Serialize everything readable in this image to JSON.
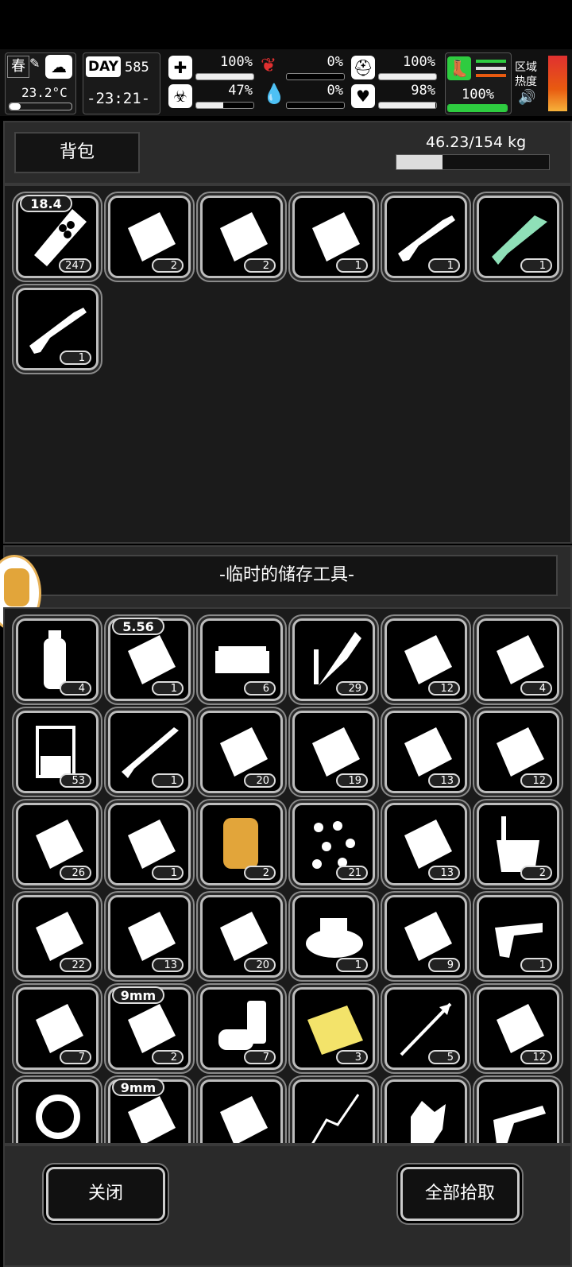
{
  "hud": {
    "season": "春",
    "temperature": "23.2°C",
    "day_label": "DAY",
    "day_number": "585",
    "clock": "-23:21-",
    "health_pct": "100%",
    "health_fill": 1.0,
    "hunger_pct": "0%",
    "hunger_fill": 0.0,
    "armor_pct": "100%",
    "armor_fill": 1.0,
    "infection_pct": "47%",
    "infection_fill": 0.47,
    "thirst_pct": "0%",
    "thirst_fill": 0.0,
    "mood_pct": "98%",
    "mood_fill": 0.98,
    "stamina_pct": "100%",
    "stamina_fill": 1.0,
    "zone_heat_label_1": "区域",
    "zone_heat_label_2": "热度"
  },
  "backpack": {
    "title": "背包",
    "weight": "46.23/154 kg",
    "weight_fill": 0.3,
    "items": [
      {
        "icon": "ammo-roll-icon",
        "tag": "18.4",
        "count": "247"
      },
      {
        "icon": "cloth-rags-icon",
        "count": "2"
      },
      {
        "icon": "paper-sheet-icon",
        "count": "2"
      },
      {
        "icon": "folded-cloth-icon",
        "count": "1"
      },
      {
        "icon": "shotgun-icon",
        "count": "1"
      },
      {
        "icon": "energy-rifle-icon",
        "count": "1"
      },
      {
        "icon": "shotgun-icon",
        "count": "1"
      }
    ]
  },
  "storage": {
    "title": "-临时的储存工具-",
    "items": [
      {
        "icon": "water-bottle-icon",
        "count": "4"
      },
      {
        "icon": "rifle-bullet-icon",
        "tag": "5.56",
        "count": "1"
      },
      {
        "icon": "cash-stack-icon",
        "count": "6"
      },
      {
        "icon": "rocket-icon",
        "count": "29"
      },
      {
        "icon": "bullet-parts-icon",
        "count": "12"
      },
      {
        "icon": "ration-bar-icon",
        "count": "4"
      },
      {
        "icon": "beaker-icon",
        "count": "53"
      },
      {
        "icon": "hunting-rifle-icon",
        "count": "1"
      },
      {
        "icon": "food-pack-icon",
        "count": "20"
      },
      {
        "icon": "folded-cloth-icon",
        "count": "19"
      },
      {
        "icon": "shell-parts-icon",
        "count": "13"
      },
      {
        "icon": "shotgun-shells-icon",
        "count": "12"
      },
      {
        "icon": "cloth-rags-icon",
        "count": "26"
      },
      {
        "icon": "paper-roll-icon",
        "count": "1"
      },
      {
        "icon": "tape-roll-icon",
        "count": "2"
      },
      {
        "icon": "pellets-icon",
        "count": "21"
      },
      {
        "icon": "torn-shirt-icon",
        "count": "13"
      },
      {
        "icon": "bucket-icon",
        "count": "2"
      },
      {
        "icon": "paper-sheet-icon",
        "count": "22"
      },
      {
        "icon": "bullet-tip-icon",
        "count": "13"
      },
      {
        "icon": "food-pack-icon",
        "count": "20"
      },
      {
        "icon": "food-bowl-icon",
        "count": "1"
      },
      {
        "icon": "bullet-head-icon",
        "count": "9"
      },
      {
        "icon": "pistol-parts-icon",
        "count": "1"
      },
      {
        "icon": "bullet-heads-icon",
        "count": "7"
      },
      {
        "icon": "pistol-bullet-icon",
        "tag": "9mm",
        "count": "2"
      },
      {
        "icon": "cans-icon",
        "count": "7"
      },
      {
        "icon": "yellow-cloth-icon",
        "count": "3"
      },
      {
        "icon": "arrow-icon",
        "count": "5"
      },
      {
        "icon": "blanket-icon",
        "count": "12"
      },
      {
        "icon": "rope-icon",
        "count": ""
      },
      {
        "icon": "pistol-bullet-icon",
        "tag": "9mm",
        "count": ""
      },
      {
        "icon": "bandage-icon",
        "count": ""
      },
      {
        "icon": "wire-icon",
        "count": ""
      },
      {
        "icon": "glove-icon",
        "count": ""
      },
      {
        "icon": "revolver-icon",
        "count": ""
      }
    ]
  },
  "buttons": {
    "close": "关闭",
    "pickup_all": "全部拾取"
  },
  "colors": {
    "accent_green": "#2ecc40",
    "danger_red": "#e03030",
    "heat_orange": "#e85a10"
  }
}
